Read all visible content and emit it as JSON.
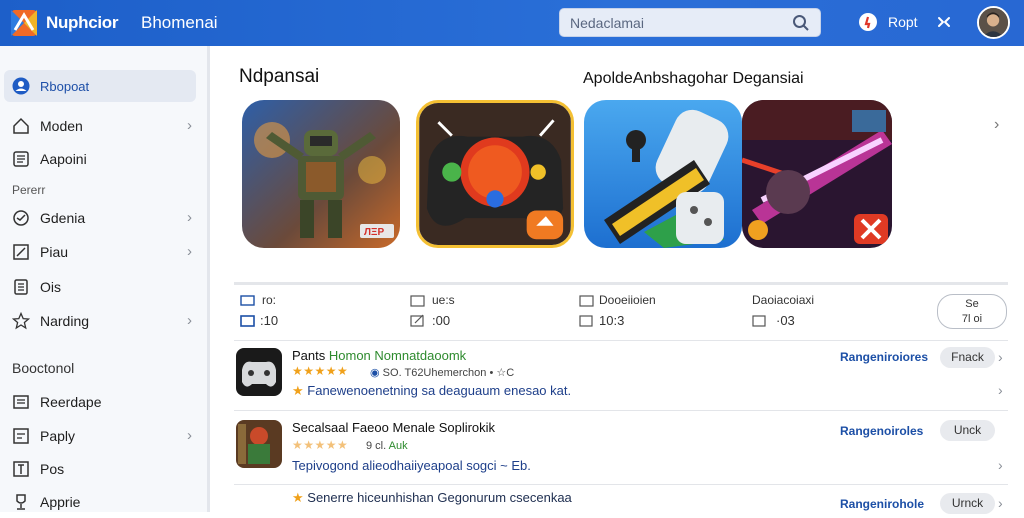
{
  "header": {
    "title": "Nuphcior",
    "subtitle": "Bhomenai",
    "search_placeholder": "Nedaclamai",
    "notification_label": "Ropt",
    "accent": "#2a6fd8"
  },
  "sidebar": {
    "items": [
      {
        "label": "Rbopoat",
        "icon": "user-circle-icon",
        "active": true,
        "chevron": false
      },
      {
        "label": "Moden",
        "icon": "home-icon",
        "chevron": true
      },
      {
        "label": "Aapoini",
        "icon": "list-icon",
        "chevron": false
      },
      {
        "label": "Gdenia",
        "icon": "clock-icon",
        "chevron": true
      },
      {
        "label": "Piau",
        "icon": "edit-icon",
        "chevron": true
      },
      {
        "label": "Ois",
        "icon": "document-icon",
        "chevron": false
      },
      {
        "label": "Narding",
        "icon": "star-icon",
        "chevron": true
      },
      {
        "label": "Reerdape",
        "icon": "book-icon",
        "chevron": false
      },
      {
        "label": "Paply",
        "icon": "note-icon",
        "chevron": true
      },
      {
        "label": "Pos",
        "icon": "text-icon",
        "chevron": false
      },
      {
        "label": "Apprie",
        "icon": "trophy-icon",
        "chevron": false
      }
    ],
    "sections": [
      "Pererr",
      "Booctonol"
    ]
  },
  "main": {
    "title": "Ndpansai",
    "subtitle": "ApoldeAnbshagohar Degansiai",
    "tiles": [
      "soldier-game-art",
      "gamepad-art",
      "controller-blue-art",
      "neon-shooter-art"
    ]
  },
  "stats": [
    {
      "top": "ro:",
      "bottom": ":10"
    },
    {
      "top": "ue:s",
      "bottom": ":00"
    },
    {
      "top": "Dooeiioien",
      "bottom": "10:3"
    },
    {
      "top": "Daoiacoiaxi",
      "bottom": "·03"
    }
  ],
  "stat_box": {
    "top": "Se",
    "bottom": "7l  oi"
  },
  "rows": [
    {
      "title_plain": "Pants",
      "title_green": "Homon Nomnatdaoomk",
      "stars_on": 5,
      "stars_off": 0,
      "meta": "SO. T62Uhemerchon",
      "meta_extra": "• ☆C",
      "desc": "Fanewenoenetning sa deaguaum enesao kat.",
      "link": "Rangeniroiores",
      "button": "Fnack"
    },
    {
      "title_plain": "Secalsaal Faeoo Menale Soplirokik",
      "title_green": "",
      "stars_on": 0,
      "stars_off": 5,
      "meta": "9 cl.",
      "meta_extra": "Auk",
      "desc": "Tepivogond alieodhaiiyeapoal sogci ~ Eb.",
      "link": "Rangenoiroles",
      "button": "Unck"
    },
    {
      "title_plain": "",
      "title_green": "",
      "stars_on": 0,
      "stars_off": 0,
      "meta": "",
      "meta_extra": "",
      "desc": "Senerre hiceunhishan Gegonurum csecenkaa",
      "link": "Rangenirohole",
      "button": "Urnck"
    }
  ]
}
